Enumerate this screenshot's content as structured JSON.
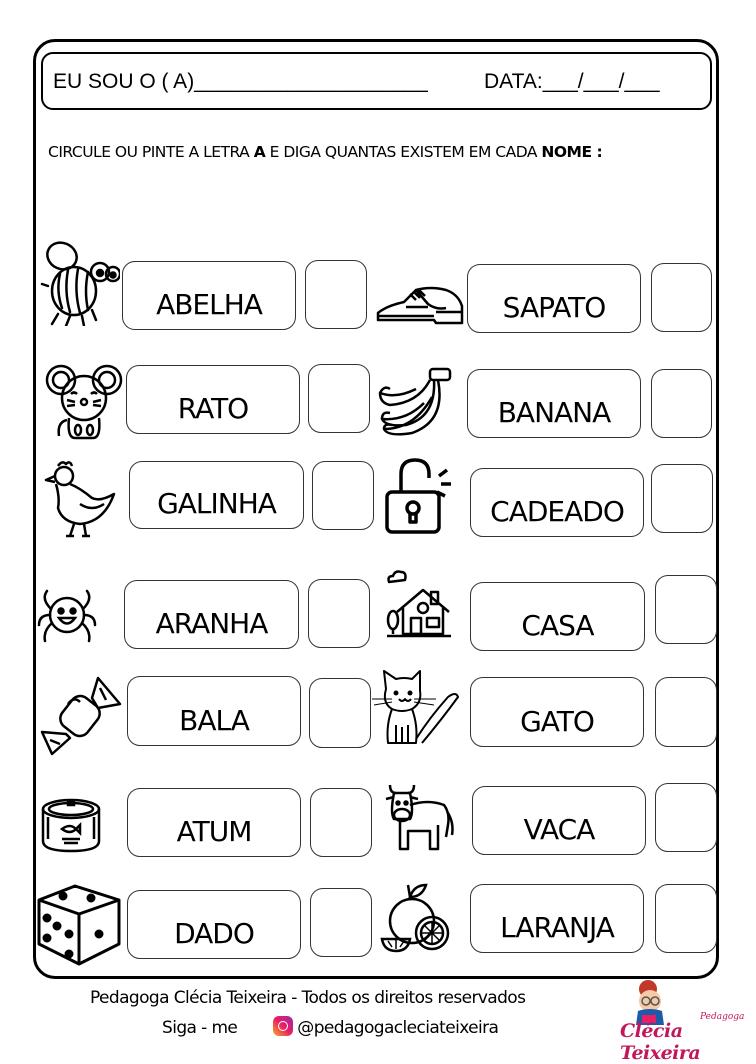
{
  "header": {
    "name_label": "EU SOU O ( A)____________________",
    "date_label": "DATA:___/___/___"
  },
  "instructions": {
    "part1": "CIRCULE OU PINTE A LETRA ",
    "letter": "A",
    "part2": "  E DIGA QUANTAS EXISTEM ",
    "part3": "EM CADA ",
    "part4": "NOME :"
  },
  "items": [
    {
      "word": "ABELHA",
      "icon": "bee-icon"
    },
    {
      "word": "SAPATO",
      "icon": "shoe-icon"
    },
    {
      "word": "RATO",
      "icon": "mouse-icon"
    },
    {
      "word": "BANANA",
      "icon": "banana-icon"
    },
    {
      "word": "GALINHA",
      "icon": "hen-icon"
    },
    {
      "word": "CADEADO",
      "icon": "padlock-icon"
    },
    {
      "word": "ARANHA",
      "icon": "spider-icon"
    },
    {
      "word": "CASA",
      "icon": "house-icon"
    },
    {
      "word": "BALA",
      "icon": "candy-icon"
    },
    {
      "word": "GATO",
      "icon": "cat-icon"
    },
    {
      "word": "ATUM",
      "icon": "tuna-can-icon"
    },
    {
      "word": "VACA",
      "icon": "cow-icon"
    },
    {
      "word": "DADO",
      "icon": "dice-icon"
    },
    {
      "word": "LARANJA",
      "icon": "orange-icon"
    }
  ],
  "footer": {
    "copyright": "Pedagoga Clécia Teixeira - Todos os direitos reservados",
    "follow": "Siga - me",
    "handle": "@pedagogacleciateixeira",
    "logo_small": "Pedagoga",
    "logo_text": "Clécia Teixeira"
  }
}
